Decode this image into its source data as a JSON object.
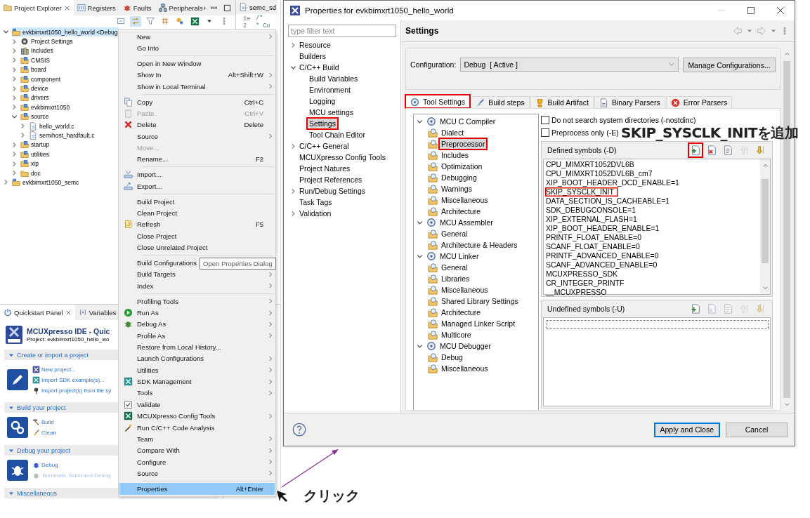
{
  "ide": {
    "explorer_tabs": [
      {
        "label": "Project Explorer",
        "selected": true
      },
      {
        "label": "Registers",
        "selected": false
      },
      {
        "label": "Faults",
        "selected": false
      },
      {
        "label": "Peripherals+",
        "selected": false
      }
    ],
    "editor_tab": {
      "label": "semc_sd"
    },
    "editor_lines": [
      {
        "number": "1⊖",
        "text": "/*"
      },
      {
        "number": "2",
        "text": " * Co"
      }
    ],
    "project_tree": [
      {
        "label": "evkbimxrt1050_hello_world <Debug",
        "kind": "project",
        "expanded": true,
        "selected": true,
        "children": [
          {
            "label": "Project Settings",
            "kind": "settings",
            "expanded": false,
            "selected": false
          },
          {
            "label": "Includes",
            "kind": "includes",
            "expanded": false,
            "selected": false
          },
          {
            "label": "CMSIS",
            "kind": "source-folder",
            "expanded": false,
            "selected": false
          },
          {
            "label": "board",
            "kind": "source-folder",
            "expanded": false,
            "selected": false
          },
          {
            "label": "component",
            "kind": "source-folder",
            "expanded": false,
            "selected": false
          },
          {
            "label": "device",
            "kind": "source-folder",
            "expanded": false,
            "selected": false
          },
          {
            "label": "drivers",
            "kind": "source-folder",
            "expanded": false,
            "selected": false
          },
          {
            "label": "evkbimxrt1050",
            "kind": "source-folder",
            "expanded": false,
            "selected": false
          },
          {
            "label": "source",
            "kind": "source-folder",
            "expanded": true,
            "selected": false,
            "children": [
              {
                "label": "hello_world.c",
                "kind": "file",
                "expanded": false,
                "selected": false
              },
              {
                "label": "semihost_hardfault.c",
                "kind": "file",
                "expanded": false,
                "selected": false
              }
            ]
          },
          {
            "label": "startup",
            "kind": "source-folder",
            "expanded": false,
            "selected": false
          },
          {
            "label": "utilities",
            "kind": "source-folder",
            "expanded": false,
            "selected": false
          },
          {
            "label": "xip",
            "kind": "source-folder",
            "expanded": false,
            "selected": false
          },
          {
            "label": "doc",
            "kind": "folder",
            "expanded": false,
            "selected": false
          }
        ]
      },
      {
        "label": "evkbimxrt1050_semc",
        "kind": "project",
        "expanded": false,
        "selected": false
      }
    ],
    "quickstart_tabs": [
      {
        "label": "Quickstart Panel",
        "selected": true
      },
      {
        "label": "Variables",
        "selected": false
      }
    ],
    "quickstart_title": "MCUXpresso IDE - Quic",
    "quickstart_project": "Project: evkbimxrt1050_hello_wo",
    "quickstart_sections": [
      {
        "title": "Create or import a project",
        "expanded": true,
        "links": [
          {
            "label": "New project...",
            "disabled": false
          },
          {
            "label": "Import SDK example(s)...",
            "disabled": false
          },
          {
            "label": "Import project(s) from file sy",
            "disabled": false
          }
        ]
      },
      {
        "title": "Build your project",
        "expanded": true,
        "links": [
          {
            "label": "Build",
            "disabled": false
          },
          {
            "label": "Clean",
            "disabled": false
          }
        ]
      },
      {
        "title": "Debug your project",
        "expanded": true,
        "links": [
          {
            "label": "Debug",
            "disabled": false
          },
          {
            "label": "Terminate, Build and Debug",
            "disabled": true
          }
        ]
      },
      {
        "title": "Miscellaneous",
        "expanded": true
      }
    ]
  },
  "context_menu": {
    "items": [
      {
        "kind": "item",
        "label": "New",
        "submenu": true,
        "disabled": false,
        "selected": false
      },
      {
        "kind": "item",
        "label": "Go Into",
        "submenu": false,
        "disabled": false,
        "selected": false
      },
      {
        "kind": "separator"
      },
      {
        "kind": "item",
        "label": "Open in New Window",
        "submenu": false,
        "disabled": false,
        "selected": false
      },
      {
        "kind": "item",
        "label": "Show In",
        "shortcut": "Alt+Shift+W",
        "submenu": true,
        "disabled": false,
        "selected": false
      },
      {
        "kind": "item",
        "label": "Show in Local Terminal",
        "submenu": true,
        "disabled": false,
        "selected": false
      },
      {
        "kind": "separator"
      },
      {
        "kind": "item",
        "label": "Copy",
        "shortcut": "Ctrl+C",
        "submenu": false,
        "disabled": false,
        "selected": false
      },
      {
        "kind": "item",
        "label": "Paste",
        "shortcut": "Ctrl+V",
        "submenu": false,
        "disabled": true,
        "selected": false
      },
      {
        "kind": "item",
        "label": "Delete",
        "shortcut": "Delete",
        "submenu": false,
        "disabled": false,
        "selected": false
      },
      {
        "kind": "item",
        "label": "Source",
        "submenu": true,
        "disabled": false,
        "selected": false
      },
      {
        "kind": "item",
        "label": "Move...",
        "submenu": false,
        "disabled": true,
        "selected": false
      },
      {
        "kind": "item",
        "label": "Rename...",
        "shortcut": "F2",
        "submenu": false,
        "disabled": false,
        "selected": false
      },
      {
        "kind": "separator"
      },
      {
        "kind": "item",
        "label": "Import...",
        "submenu": false,
        "disabled": false,
        "selected": false
      },
      {
        "kind": "item",
        "label": "Export...",
        "submenu": false,
        "disabled": false,
        "selected": false
      },
      {
        "kind": "separator"
      },
      {
        "kind": "item",
        "label": "Build Project",
        "submenu": false,
        "disabled": false,
        "selected": false
      },
      {
        "kind": "item",
        "label": "Clean Project",
        "submenu": false,
        "disabled": false,
        "selected": false
      },
      {
        "kind": "item",
        "label": "Refresh",
        "shortcut": "F5",
        "submenu": false,
        "disabled": false,
        "selected": false
      },
      {
        "kind": "item",
        "label": "Close Project",
        "submenu": false,
        "disabled": false,
        "selected": false
      },
      {
        "kind": "item",
        "label": "Close Unrelated Project",
        "submenu": false,
        "disabled": false,
        "selected": false
      },
      {
        "kind": "separator"
      },
      {
        "kind": "item",
        "label": "Build Configurations",
        "submenu": true,
        "disabled": false,
        "selected": false
      },
      {
        "kind": "item",
        "label": "Build Targets",
        "submenu": true,
        "disabled": false,
        "selected": false
      },
      {
        "kind": "item",
        "label": "Index",
        "submenu": true,
        "disabled": false,
        "selected": false
      },
      {
        "kind": "separator"
      },
      {
        "kind": "item",
        "label": "Profiling Tools",
        "submenu": true,
        "disabled": false,
        "selected": false
      },
      {
        "kind": "item",
        "label": "Run As",
        "submenu": true,
        "disabled": false,
        "selected": false
      },
      {
        "kind": "item",
        "label": "Debug As",
        "submenu": true,
        "disabled": false,
        "selected": false
      },
      {
        "kind": "item",
        "label": "Profile As",
        "submenu": true,
        "disabled": false,
        "selected": false
      },
      {
        "kind": "item",
        "label": "Restore from Local History...",
        "submenu": false,
        "disabled": false,
        "selected": false
      },
      {
        "kind": "item",
        "label": "Launch Configurations",
        "submenu": true,
        "disabled": false,
        "selected": false
      },
      {
        "kind": "item",
        "label": "Utilities",
        "submenu": true,
        "disabled": false,
        "selected": false
      },
      {
        "kind": "item",
        "label": "SDK Management",
        "submenu": true,
        "disabled": false,
        "selected": false
      },
      {
        "kind": "item",
        "label": "Tools",
        "submenu": true,
        "disabled": false,
        "selected": false
      },
      {
        "kind": "item",
        "label": "Validate",
        "submenu": false,
        "disabled": false,
        "selected": false
      },
      {
        "kind": "item",
        "label": "MCUXpresso Config Tools",
        "submenu": true,
        "disabled": false,
        "selected": false
      },
      {
        "kind": "item",
        "label": "Run C/C++ Code Analysis",
        "submenu": false,
        "disabled": false,
        "selected": false
      },
      {
        "kind": "item",
        "label": "Team",
        "submenu": true,
        "disabled": false,
        "selected": false
      },
      {
        "kind": "item",
        "label": "Compare With",
        "submenu": true,
        "disabled": false,
        "selected": false
      },
      {
        "kind": "item",
        "label": "Configure",
        "submenu": true,
        "disabled": false,
        "selected": false
      },
      {
        "kind": "item",
        "label": "Source",
        "submenu": true,
        "disabled": false,
        "selected": false
      },
      {
        "kind": "separator"
      },
      {
        "kind": "item",
        "label": "Properties",
        "shortcut": "Alt+Enter",
        "submenu": false,
        "disabled": false,
        "selected": true
      }
    ],
    "tooltip": "Open Properties Dialog"
  },
  "dialog": {
    "title": "Properties for evkbimxrt1050_hello_world",
    "filter_placeholder": "type filter text",
    "nav": [
      {
        "label": "Resource",
        "expanded": false,
        "selected": false,
        "highlighted": false
      },
      {
        "label": "Builders",
        "selected": false,
        "highlighted": false
      },
      {
        "label": "C/C++ Build",
        "expanded": true,
        "selected": false,
        "highlighted": false,
        "children": [
          {
            "label": "Build Variables",
            "selected": false,
            "highlighted": false
          },
          {
            "label": "Environment",
            "selected": false,
            "highlighted": false
          },
          {
            "label": "Logging",
            "selected": false,
            "highlighted": false
          },
          {
            "label": "MCU settings",
            "selected": false,
            "highlighted": false
          },
          {
            "label": "Settings",
            "selected": true,
            "highlighted": true
          },
          {
            "label": "Tool Chain Editor",
            "selected": false,
            "highlighted": false
          }
        ]
      },
      {
        "label": "C/C++ General",
        "expanded": false,
        "selected": false,
        "highlighted": false
      },
      {
        "label": "MCUXpresso Config Tools",
        "selected": false,
        "highlighted": false
      },
      {
        "label": "Project Natures",
        "selected": false,
        "highlighted": false
      },
      {
        "label": "Project References",
        "selected": false,
        "highlighted": false
      },
      {
        "label": "Run/Debug Settings",
        "expanded": false,
        "selected": false,
        "highlighted": false
      },
      {
        "label": "Task Tags",
        "selected": false,
        "highlighted": false
      },
      {
        "label": "Validation",
        "expanded": false,
        "selected": false,
        "highlighted": false
      }
    ],
    "heading": "Settings",
    "configuration": {
      "label": "Configuration:",
      "value": "Debug  [ Active ]",
      "button": "Manage Configurations..."
    },
    "tabs": [
      {
        "label": "Tool Settings",
        "selected": true,
        "highlighted": true
      },
      {
        "label": "Build steps",
        "selected": false,
        "highlighted": false
      },
      {
        "label": "Build Artifact",
        "selected": false,
        "highlighted": false
      },
      {
        "label": "Binary Parsers",
        "selected": false,
        "highlighted": false
      },
      {
        "label": "Error Parsers",
        "selected": false,
        "highlighted": false
      }
    ],
    "tool_tree": [
      {
        "label": "MCU C Compiler",
        "expanded": true,
        "selected": false,
        "highlighted": false,
        "children": [
          {
            "label": "Dialect",
            "selected": false,
            "highlighted": false
          },
          {
            "label": "Preprocessor",
            "selected": true,
            "highlighted": true
          },
          {
            "label": "Includes",
            "selected": false,
            "highlighted": false
          },
          {
            "label": "Optimization",
            "selected": false,
            "highlighted": false
          },
          {
            "label": "Debugging",
            "selected": false,
            "highlighted": false
          },
          {
            "label": "Warnings",
            "selected": false,
            "highlighted": false
          },
          {
            "label": "Miscellaneous",
            "selected": false,
            "highlighted": false
          },
          {
            "label": "Architecture",
            "selected": false,
            "highlighted": false
          }
        ]
      },
      {
        "label": "MCU Assembler",
        "expanded": true,
        "selected": false,
        "highlighted": false,
        "children": [
          {
            "label": "General",
            "selected": false,
            "highlighted": false
          },
          {
            "label": "Architecture & Headers",
            "selected": false,
            "highlighted": false
          }
        ]
      },
      {
        "label": "MCU Linker",
        "expanded": true,
        "selected": false,
        "highlighted": false,
        "children": [
          {
            "label": "General",
            "selected": false,
            "highlighted": false
          },
          {
            "label": "Libraries",
            "selected": false,
            "highlighted": false
          },
          {
            "label": "Miscellaneous",
            "selected": false,
            "highlighted": false
          },
          {
            "label": "Shared Library Settings",
            "selected": false,
            "highlighted": false
          },
          {
            "label": "Architecture",
            "selected": false,
            "highlighted": false
          },
          {
            "label": "Managed Linker Script",
            "selected": false,
            "highlighted": false
          },
          {
            "label": "Multicore",
            "selected": false,
            "highlighted": false
          }
        ]
      },
      {
        "label": "MCU Debugger",
        "expanded": true,
        "selected": false,
        "highlighted": false,
        "children": [
          {
            "label": "Debug",
            "selected": false,
            "highlighted": false
          },
          {
            "label": "Miscellaneous",
            "selected": false,
            "highlighted": false
          }
        ]
      }
    ],
    "options": [
      {
        "label": "Do not search system directories (-nostdinc)",
        "checked": false
      },
      {
        "label": "Preprocess only (-E)",
        "checked": false
      }
    ],
    "defined": {
      "title": "Defined symbols (-D)",
      "tools": [
        {
          "kind": "add",
          "disabled": false,
          "highlighted": true
        },
        {
          "kind": "delete",
          "disabled": false,
          "highlighted": false
        },
        {
          "kind": "edit",
          "disabled": false,
          "highlighted": false
        },
        {
          "kind": "up",
          "disabled": true,
          "highlighted": false
        },
        {
          "kind": "down",
          "disabled": false,
          "highlighted": false
        }
      ],
      "symbols": [
        {
          "label": "CPU_MIMXRT1052DVL6B",
          "highlighted": false
        },
        {
          "label": "CPU_MIMXRT1052DVL6B_cm7",
          "highlighted": false
        },
        {
          "label": "XIP_BOOT_HEADER_DCD_ENABLE=1",
          "highlighted": false
        },
        {
          "label": "SKIP_SYSCLK_INIT",
          "highlighted": true
        },
        {
          "label": "DATA_SECTION_IS_CACHEABLE=1",
          "highlighted": false
        },
        {
          "label": "SDK_DEBUGCONSOLE=1",
          "highlighted": false
        },
        {
          "label": "XIP_EXTERNAL_FLASH=1",
          "highlighted": false
        },
        {
          "label": "XIP_BOOT_HEADER_ENABLE=1",
          "highlighted": false
        },
        {
          "label": "PRINTF_FLOAT_ENABLE=0",
          "highlighted": false
        },
        {
          "label": "SCANF_FLOAT_ENABLE=0",
          "highlighted": false
        },
        {
          "label": "PRINTF_ADVANCED_ENABLE=0",
          "highlighted": false
        },
        {
          "label": "SCANF_ADVANCED_ENABLE=0",
          "highlighted": false
        },
        {
          "label": "MCUXPRESSO_SDK",
          "highlighted": false
        },
        {
          "label": "CR_INTEGER_PRINTF",
          "highlighted": false
        },
        {
          "label": "__MCUXPRESSO",
          "highlighted": false
        }
      ]
    },
    "undefined": {
      "title": "Undefined symbols (-U)",
      "tools": [
        {
          "kind": "add",
          "disabled": false,
          "highlighted": false
        },
        {
          "kind": "delete",
          "disabled": true,
          "highlighted": false
        },
        {
          "kind": "edit",
          "disabled": true,
          "highlighted": false
        },
        {
          "kind": "up",
          "disabled": true,
          "highlighted": false
        },
        {
          "kind": "down",
          "disabled": true,
          "highlighted": false
        }
      ]
    },
    "buttons": [
      {
        "label": "Apply and Close",
        "default": true
      },
      {
        "label": "Cancel",
        "default": false
      }
    ]
  },
  "annotations": {
    "callout": "SKIP_SYSCLK_INITを追加",
    "click": "クリック"
  }
}
